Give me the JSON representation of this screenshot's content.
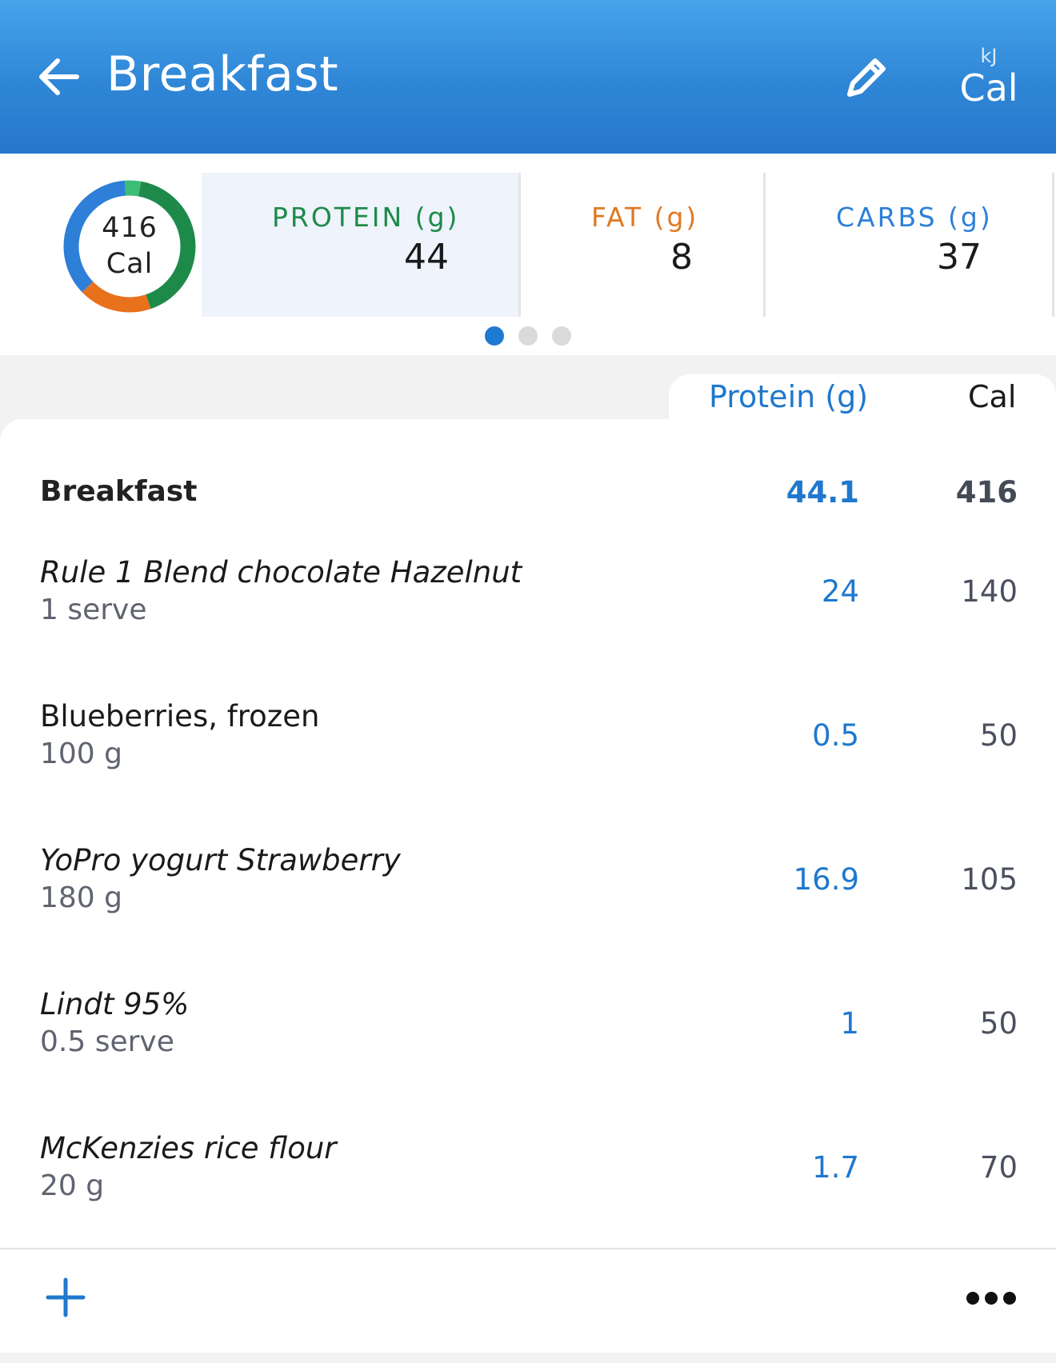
{
  "header": {
    "title": "Breakfast",
    "unit_toggle": {
      "alt": "kJ",
      "selected": "Cal"
    }
  },
  "summary": {
    "ring": {
      "value": "416",
      "unit": "Cal",
      "segments": [
        {
          "name": "protein",
          "color": "#1e8a4a",
          "fraction": 0.42
        },
        {
          "name": "fat",
          "color": "#e8711c",
          "fraction": 0.18
        },
        {
          "name": "carbs",
          "color": "#2d7fd8",
          "fraction": 0.36
        },
        {
          "name": "other",
          "color": "#3cbd74",
          "fraction": 0.04
        }
      ]
    },
    "macros": [
      {
        "label": "PROTEIN (g)",
        "value": "44",
        "color": "#1e8a4a",
        "active": true
      },
      {
        "label": "FAT (g)",
        "value": "8",
        "color": "#e07822",
        "active": false
      },
      {
        "label": "CARBS (g)",
        "value": "37",
        "color": "#2d7fd8",
        "active": false
      }
    ],
    "pager": {
      "pages": 3,
      "current": 1
    }
  },
  "columns": {
    "protein": "Protein (g)",
    "cal": "Cal"
  },
  "meal_total": {
    "name": "Breakfast",
    "protein": "44.1",
    "cal": "416"
  },
  "items": [
    {
      "name": "Rule 1 Blend chocolate Hazelnut",
      "qty": "1 serve",
      "protein": "24",
      "cal": "140",
      "italic": true
    },
    {
      "name": "Blueberries, frozen",
      "qty": "100 g",
      "protein": "0.5",
      "cal": "50",
      "italic": false
    },
    {
      "name": "YoPro yogurt Strawberry",
      "qty": "180 g",
      "protein": "16.9",
      "cal": "105",
      "italic": true
    },
    {
      "name": "Lindt 95%",
      "qty": "0.5 serve",
      "protein": "1",
      "cal": "50",
      "italic": true
    },
    {
      "name": "McKenzies rice flour",
      "qty": "20 g",
      "protein": "1.7",
      "cal": "70",
      "italic": true
    }
  ],
  "icons": {
    "back": "arrow-left-icon",
    "edit": "pencil-icon",
    "add": "plus-icon",
    "more": "more-horizontal-icon"
  }
}
